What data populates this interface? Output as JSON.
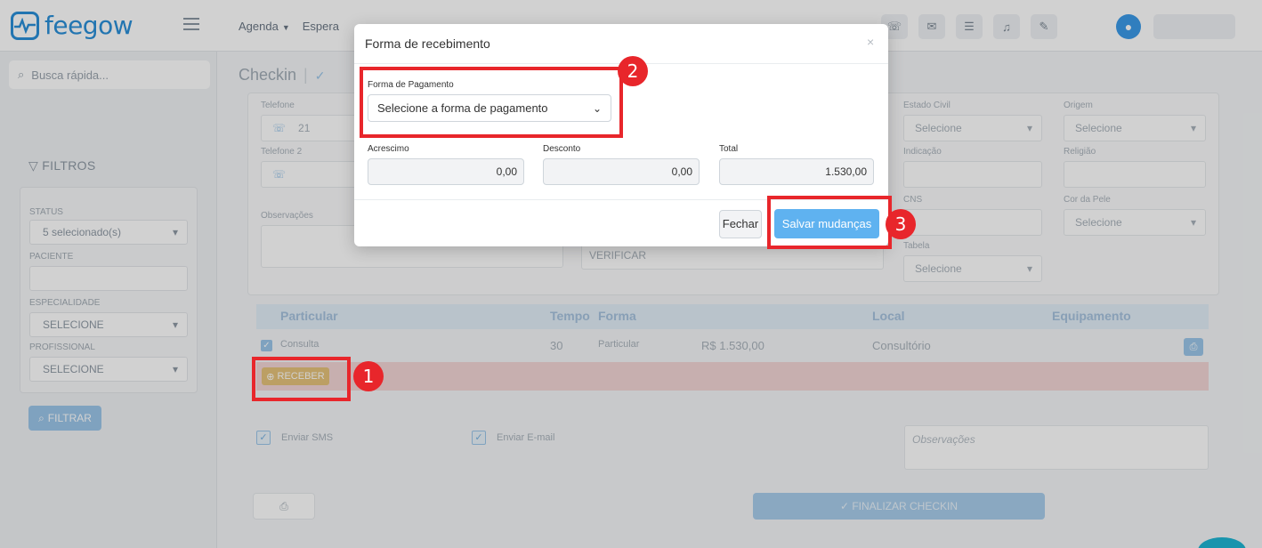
{
  "brand": {
    "logo_text": "feegow"
  },
  "topnav": {
    "items": [
      "Agenda",
      "Espera"
    ]
  },
  "sidebar": {
    "search_placeholder": "Busca rápida...",
    "filters_title": "FILTROS",
    "status_label": "STATUS",
    "status_value": "5 selecionado(s)",
    "paciente_label": "PACIENTE",
    "especialidade_label": "ESPECIALIDADE",
    "especialidade_value": "SELECIONE",
    "profissional_label": "PROFISSIONAL",
    "profissional_value": "SELECIONE",
    "filter_button": "FILTRAR"
  },
  "main": {
    "title": "Checkin",
    "telefone_label": "Telefone",
    "telefone_value": "21",
    "telefone2_label": "Telefone 2",
    "observacoes_label": "Observações",
    "verificar_text": "VERIFICAR",
    "estado_civil_label": "Estado Civil",
    "estado_civil_value": "Selecione",
    "origem_label": "Origem",
    "origem_value": "Selecione",
    "indicacao_label": "Indicação",
    "religiao_label": "Religião",
    "cns_label": "CNS",
    "cor_pele_label": "Cor da Pele",
    "cor_pele_value": "Selecione",
    "tabela_label": "Tabela",
    "tabela_value": "Selecione"
  },
  "table": {
    "headers": [
      "Particular",
      "Tempo",
      "Forma",
      "Local",
      "Equipamento"
    ],
    "row": {
      "procedure": "Consulta",
      "tempo": "30",
      "forma": "Particular",
      "valor": "R$ 1.530,00",
      "local": "Consultório"
    },
    "receber_button": "RECEBER"
  },
  "bottom": {
    "enviar_sms": "Enviar SMS",
    "enviar_email": "Enviar E-mail",
    "observacoes_placeholder": "Observações",
    "finalizar_button": "FINALIZAR CHECKIN"
  },
  "modal": {
    "title": "Forma de recebimento",
    "forma_pagamento_label": "Forma de Pagamento",
    "forma_pagamento_value": "Selecione a forma de pagamento",
    "acrescimo_label": "Acrescimo",
    "acrescimo_value": "0,00",
    "desconto_label": "Desconto",
    "desconto_value": "0,00",
    "total_label": "Total",
    "total_value": "1.530,00",
    "fechar_button": "Fechar",
    "salvar_button": "Salvar mudanças"
  },
  "annotations": {
    "step1": "1",
    "step2": "2",
    "step3": "3"
  },
  "colors": {
    "accent": "#2a8fd8",
    "annotation": "#e8262b",
    "primary_button": "#5fb2f0"
  }
}
